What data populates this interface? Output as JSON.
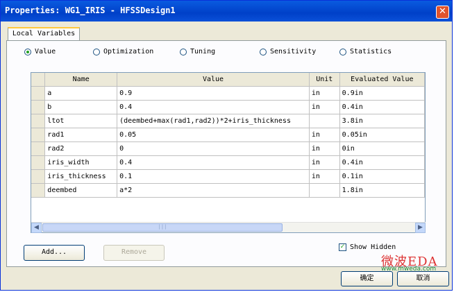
{
  "window": {
    "title": "Properties: WG1_IRIS - HFSSDesign1",
    "close_glyph": "✕"
  },
  "tab": {
    "label": "Local Variables"
  },
  "radios": [
    {
      "label": "Value",
      "selected": true
    },
    {
      "label": "Optimization",
      "selected": false
    },
    {
      "label": "Tuning",
      "selected": false
    },
    {
      "label": "Sensitivity",
      "selected": false
    },
    {
      "label": "Statistics",
      "selected": false
    }
  ],
  "table": {
    "headers": [
      "Name",
      "Value",
      "Unit",
      "Evaluated Value"
    ],
    "rows": [
      [
        "a",
        "0.9",
        "in",
        "0.9in"
      ],
      [
        "b",
        "0.4",
        "in",
        "0.4in"
      ],
      [
        "ltot",
        "(deembed+max(rad1,rad2))*2+iris_thickness",
        "",
        "3.8in"
      ],
      [
        "rad1",
        "0.05",
        "in",
        "0.05in"
      ],
      [
        "rad2",
        "0",
        "in",
        "0in"
      ],
      [
        "iris_width",
        "0.4",
        "in",
        "0.4in"
      ],
      [
        "iris_thickness",
        "0.1",
        "in",
        "0.1in"
      ],
      [
        "deembed",
        "a*2",
        "",
        "1.8in"
      ]
    ]
  },
  "buttons": {
    "add": "Add...",
    "remove": "Remove",
    "ok": "确定",
    "cancel": "取消"
  },
  "show_hidden": {
    "label": "Show Hidden",
    "checked": true
  },
  "watermark": {
    "brand": "微波EDA",
    "url": "www.mweda.com"
  },
  "icons": {
    "scroll_left": "◀",
    "scroll_right": "▶",
    "grip": "|||",
    "check": "✓"
  },
  "colors": {
    "titlebar": "#0a5be0",
    "dialog": "#ece9d8",
    "close": "#e0532c"
  }
}
